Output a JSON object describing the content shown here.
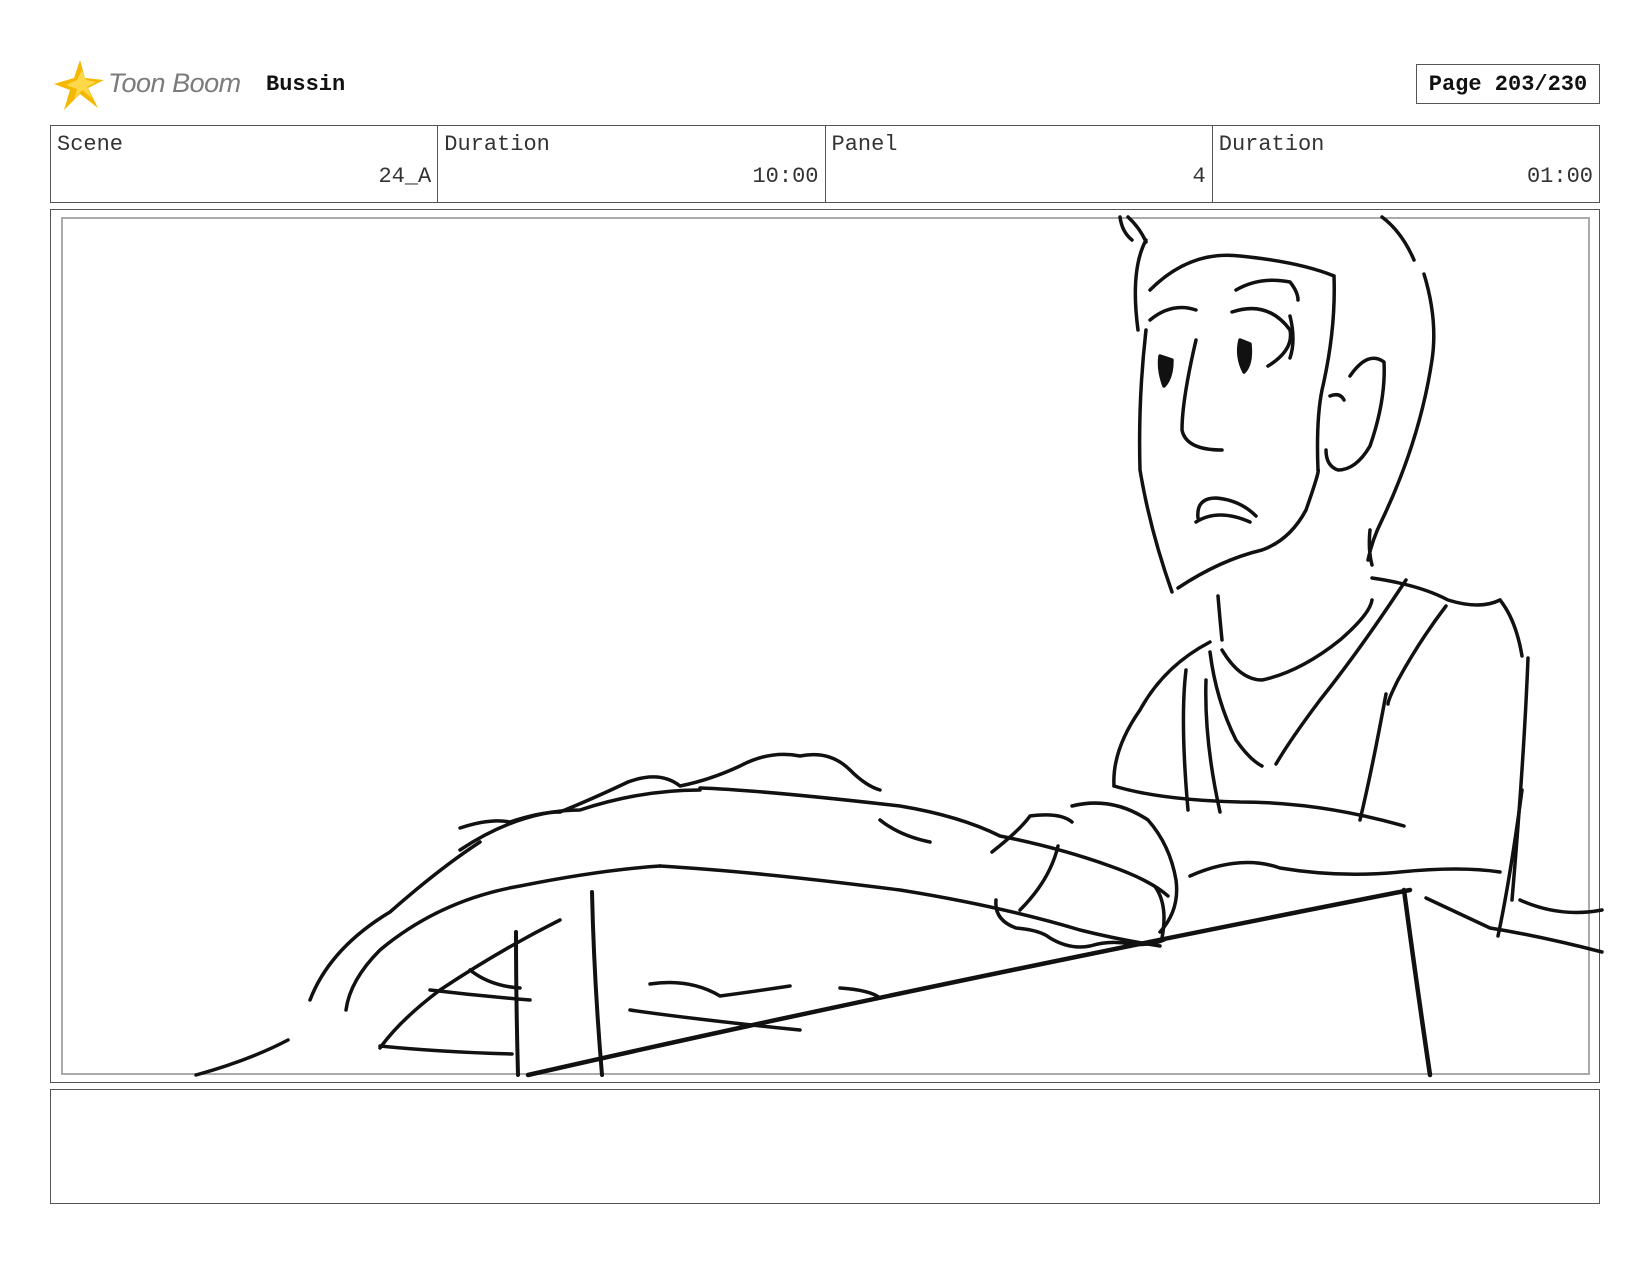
{
  "header": {
    "logo_text": "Toon Boom",
    "project_name": "Bussin",
    "page_label": "Page 203/230"
  },
  "info": {
    "scene_label": "Scene",
    "scene_value": "24_A",
    "scene_duration_label": "Duration",
    "scene_duration_value": "10:00",
    "panel_label": "Panel",
    "panel_value": "4",
    "panel_duration_label": "Duration",
    "panel_duration_value": "01:00"
  },
  "notes": {
    "text": ""
  },
  "colors": {
    "logo_star": "#f5b800",
    "logo_text": "#7b7b7b",
    "border": "#555555"
  }
}
